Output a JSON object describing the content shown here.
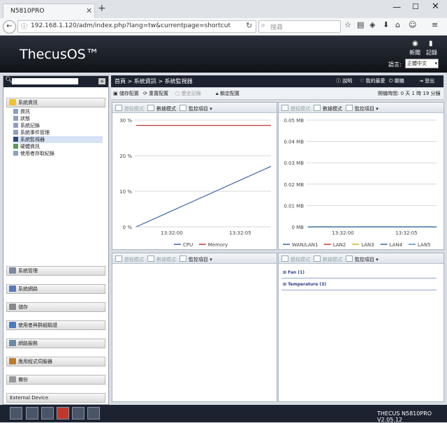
{
  "browser": {
    "tab_title": "N5810PRO",
    "url": "192.168.1.120/adm/index.php?lang=tw&currentpage=shortcut",
    "search_placeholder": "搜尋"
  },
  "header": {
    "logo": "ThecusOS™",
    "news_label": "新聞",
    "log_label": "記錄",
    "lang_label": "語言:",
    "lang_value": "正體中文"
  },
  "sidebar": {
    "section_system_info": "系統資訊",
    "items": [
      "資訊",
      "狀態",
      "系統記錄",
      "系統事件管理",
      "系統監視器",
      "硬體資訊",
      "使用者存取紀錄"
    ],
    "sections": [
      "系統管理",
      "系統網路",
      "儲存",
      "使用者與群組驗證",
      "網路服務",
      "應用程式伺服器",
      "備份",
      "External Device"
    ]
  },
  "breadcrumb": "首頁 > 系統資訊 > 系統監視器",
  "top_actions": {
    "help": "說明",
    "favorite": "我的最愛",
    "shutdown": "關機",
    "logout": "登出"
  },
  "toolbar": {
    "save": "儲存配置",
    "reset": "重置配置",
    "history": "歷史記錄",
    "lock": "鎖定配置",
    "uptime_label": "開機時間:",
    "uptime_value": "0 天 1 時 19 分鐘"
  },
  "panel_toolbar": {
    "history_mode": "歷程模式",
    "data_mode": "數據模式",
    "monitor_items": "監控項目"
  },
  "cpu_chart": {
    "yticks": [
      "30 %",
      "20 %",
      "10 %",
      "0 %"
    ],
    "xticks": [
      "13:32:00",
      "13:32:05"
    ],
    "legend": [
      "CPU",
      "Memory"
    ]
  },
  "lan_chart": {
    "yticks": [
      "0.05 MB",
      "0.04 MB",
      "0.03 MB",
      "0.02 MB",
      "0.01 MB",
      "0 MB"
    ],
    "xticks": [
      "13:32:00",
      "13:32:05"
    ],
    "legend": [
      "WAN/LAN1",
      "LAN2",
      "LAN3",
      "LAN4",
      "LAN5"
    ]
  },
  "fan_panel": {
    "fan": "Fan (1)",
    "temperature": "Temperature (3)"
  },
  "footer": {
    "version": "THECUS N5810PRO V2.05.12"
  },
  "chart_data": [
    {
      "type": "line",
      "x": [
        "13:31:56",
        "13:32:09"
      ],
      "series": [
        {
          "name": "CPU",
          "values": [
            0,
            17
          ]
        },
        {
          "name": "Memory",
          "values": [
            28.5,
            28.5
          ]
        }
      ],
      "ylim": [
        0,
        30
      ],
      "yticks": [
        "30 %",
        "20 %",
        "10 %",
        "0 %"
      ],
      "xticks": [
        "13:32:00",
        "13:32:05"
      ],
      "colors": {
        "CPU": "#3b63a8",
        "Memory": "#c0392b"
      },
      "grid": true,
      "legend": "bottom"
    },
    {
      "type": "line",
      "series": [
        {
          "name": "WAN/LAN1",
          "values": [
            0,
            0
          ]
        },
        {
          "name": "LAN2",
          "values": [
            0,
            0
          ]
        },
        {
          "name": "LAN3",
          "values": [
            0,
            0
          ]
        },
        {
          "name": "LAN4",
          "values": [
            0,
            0
          ]
        },
        {
          "name": "LAN5",
          "values": [
            0,
            0
          ]
        }
      ],
      "ylim": [
        0,
        0.05
      ],
      "yticks": [
        "0.05 MB",
        "0.04 MB",
        "0.03 MB",
        "0.02 MB",
        "0.01 MB",
        "0 MB"
      ],
      "xticks": [
        "13:32:00",
        "13:32:05"
      ],
      "colors": {
        "WAN/LAN1": "#3b63a8",
        "LAN2": "#c0392b",
        "LAN3": "#c9b03b",
        "LAN4": "#3b63a8",
        "LAN5": "#4a90c8"
      },
      "grid": true,
      "legend": "bottom"
    }
  ]
}
